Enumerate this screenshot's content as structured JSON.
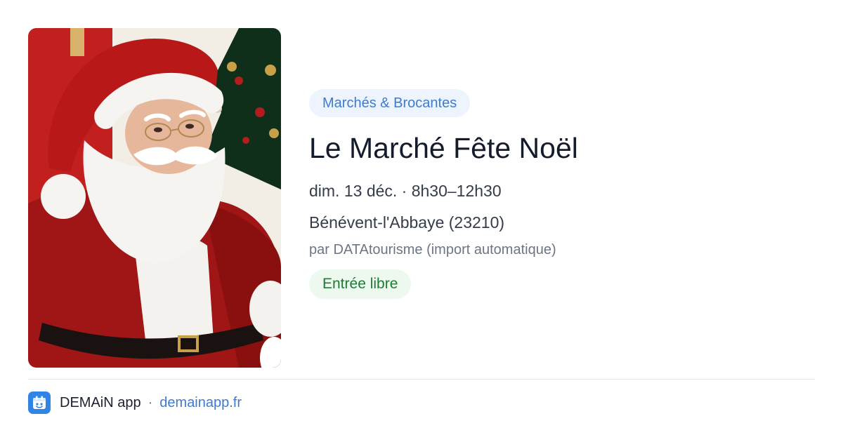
{
  "event": {
    "image_alt": "Santa Claus",
    "category": "Marchés & Brocantes",
    "title": "Le Marché Fête Noël",
    "datetime": "dim. 13 déc. · 8h30–12h30",
    "location": "Bénévent-l'Abbaye (23210)",
    "source": "par DATAtourisme (import automatique)",
    "price": "Entrée libre"
  },
  "footer": {
    "app_name": "DEMAiN app",
    "separator": "·",
    "link_text": "demainapp.fr",
    "logo_icon": "calendar-app-icon"
  },
  "colors": {
    "category_bg": "#edf4fd",
    "category_text": "#3d7bd1",
    "price_bg": "#edf9ef",
    "price_text": "#1f7a35",
    "link": "#3d7bd1",
    "logo_bg": "#2f84e6"
  }
}
